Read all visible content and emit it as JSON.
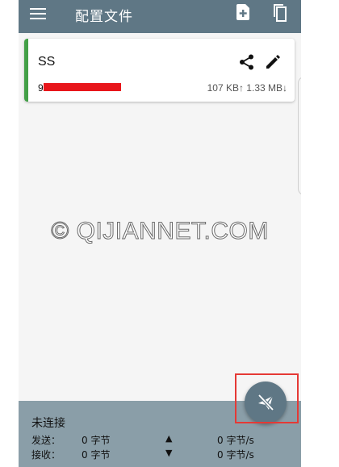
{
  "appbar": {
    "title": "配置文件",
    "icons": [
      "menu-icon",
      "add-file-icon",
      "copy-icon"
    ]
  },
  "profile": {
    "name": "SS",
    "address_prefix": "9",
    "upload": "107 KB",
    "download": "1.33 MB",
    "traffic_text": "107 KB↑ 1.33 MB↓",
    "accent_color": "#43a047",
    "icons": [
      "share-icon",
      "edit-icon"
    ]
  },
  "watermark": "© QIJIANNET.COM",
  "status": {
    "connection": "未连接",
    "send_label": "发送：",
    "receive_label": "接收：",
    "send_total": "0 字节",
    "receive_total": "0 字节",
    "send_rate": "0 字节/s",
    "receive_rate": "0 字节/s"
  },
  "fab": {
    "icon": "paper-plane-off-icon"
  },
  "colors": {
    "primary": "#5f7785",
    "status_bar": "#8a9ea8",
    "highlight": "#e53935"
  }
}
